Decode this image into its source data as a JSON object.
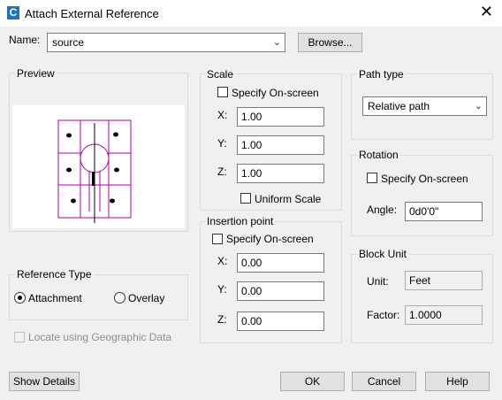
{
  "window": {
    "title": "Attach External Reference",
    "app_icon_letter": "C"
  },
  "name_row": {
    "label": "Name:",
    "value": "source",
    "browse_label": "Browse..."
  },
  "preview": {
    "title": "Preview"
  },
  "reference_type": {
    "title": "Reference Type",
    "attachment_label": "Attachment",
    "overlay_label": "Overlay",
    "selected": "Attachment"
  },
  "geo": {
    "label": "Locate using Geographic Data",
    "checked": false,
    "enabled": false
  },
  "scale": {
    "title": "Scale",
    "specify_label": "Specify On-screen",
    "x_label": "X:",
    "x_value": "1.00",
    "y_label": "Y:",
    "y_value": "1.00",
    "z_label": "Z:",
    "z_value": "1.00",
    "uniform_label": "Uniform Scale"
  },
  "insertion": {
    "title": "Insertion point",
    "specify_label": "Specify On-screen",
    "x_label": "X:",
    "x_value": "0.00",
    "y_label": "Y:",
    "y_value": "0.00",
    "z_label": "Z:",
    "z_value": "0.00"
  },
  "path_type": {
    "title": "Path type",
    "value": "Relative path"
  },
  "rotation": {
    "title": "Rotation",
    "specify_label": "Specify On-screen",
    "angle_label": "Angle:",
    "angle_value": "0d0'0\""
  },
  "block_unit": {
    "title": "Block Unit",
    "unit_label": "Unit:",
    "unit_value": "Feet",
    "factor_label": "Factor:",
    "factor_value": "1.0000"
  },
  "buttons": {
    "show_details": "Show Details",
    "ok": "OK",
    "cancel": "Cancel",
    "help": "Help"
  },
  "colors": {
    "drawing_line": "#b000b0",
    "title_icon_bg": "#1e73c8"
  }
}
